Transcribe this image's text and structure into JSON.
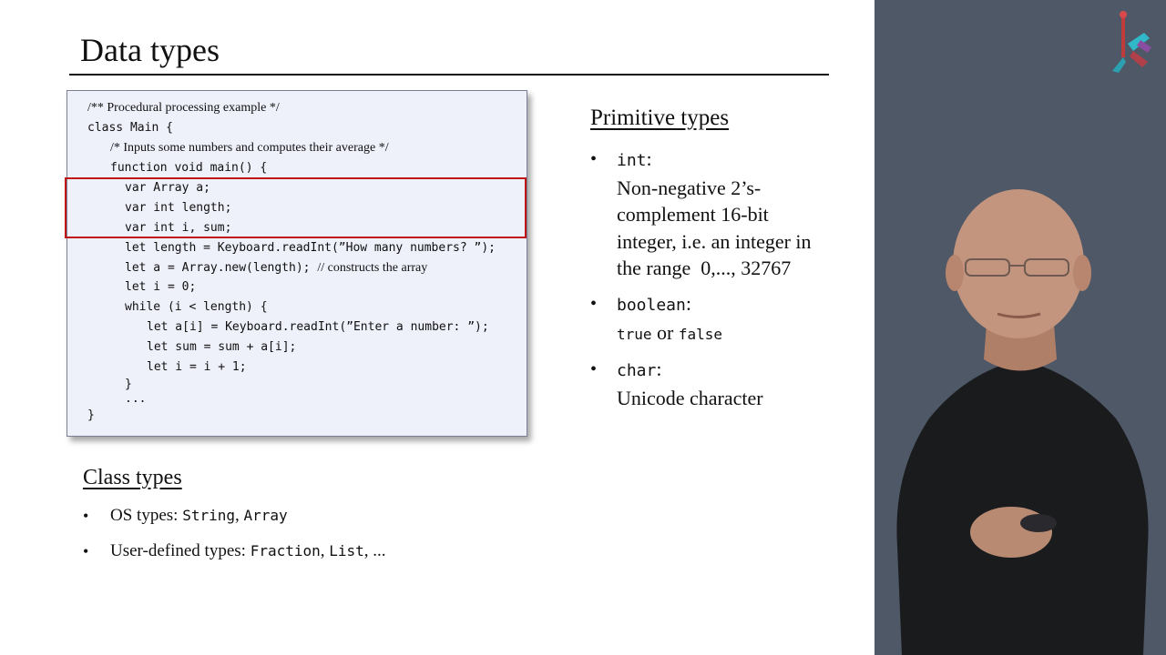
{
  "slide": {
    "title": "Data types",
    "code": {
      "lines": [
        "/** Procedural processing example */",
        "class Main {",
        "/* Inputs some numbers and computes their average */",
        "function void main() {",
        "var Array a;",
        "var int length;",
        "var int i, sum;",
        "let length = Keyboard.readInt(”How many numbers? ”);",
        "let a = Array.new(length);",
        "// constructs the array",
        "let i = 0;",
        "while (i < length) {",
        "let a[i] = Keyboard.readInt(”Enter a number: ”);",
        "let sum = sum + a[i];",
        "let i = i + 1;",
        "}",
        "...",
        "}"
      ]
    },
    "primitive": {
      "heading": "Primitive types",
      "bullet": "•",
      "int_name": "int",
      "colon": ":",
      "int_desc_1": "Non-negative 2’s-",
      "int_desc_2": "complement 16-bit",
      "int_desc_3": "integer, i.e. an integer in",
      "int_desc_4": "the range  0,..., 32767",
      "boolean_name": "boolean",
      "boolean_true": "true",
      "boolean_or": " or ",
      "boolean_false": "false",
      "char_name": "char",
      "char_desc": "Unicode character"
    },
    "class_types": {
      "heading": "Class types",
      "bullet": "•",
      "os_label": "OS types: ",
      "os_string": "String",
      "comma": ", ",
      "os_array": "Array",
      "user_label": "User-defined types: ",
      "user_fraction": "Fraction",
      "user_list": "List",
      "user_more": ", ..."
    }
  },
  "colors": {
    "code_background": "#eef0fa",
    "highlight_border": "#c01414",
    "side_panel": "#4e5866"
  },
  "icons": {
    "logo": "course-logo-icon"
  }
}
